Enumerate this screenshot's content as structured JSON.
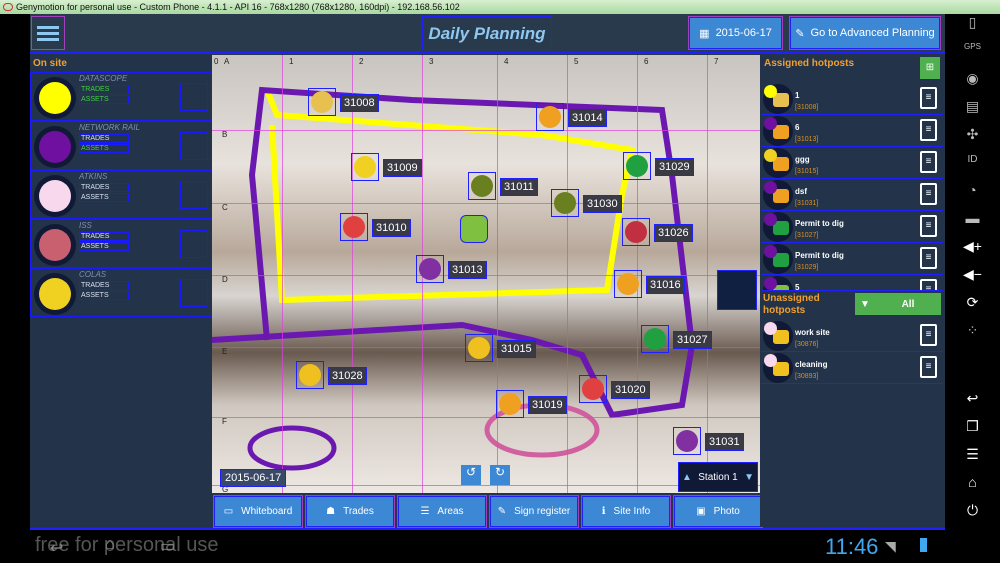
{
  "window": {
    "title": "Genymotion for personal use - Custom Phone - 4.1.1 - API 16 - 768x1280 (768x1280, 160dpi) - 192.168.56.102"
  },
  "header": {
    "title": "Daily Planning",
    "date_button": "2015-06-17",
    "advanced_button": "Go to Advanced Planning"
  },
  "onsite": {
    "heading": "On site",
    "orgs": [
      {
        "name": "DATASCOPE",
        "color": "#ffff00",
        "trades": "TRADES",
        "assets": "ASSETS",
        "trades_color": "#40d040",
        "assets_color": "#40d040"
      },
      {
        "name": "NETWORK RAIL",
        "color": "#7010a0",
        "trades": "TRADES",
        "assets": "ASSETS",
        "trades_color": "#d8e0f0",
        "assets_color": "#40d040"
      },
      {
        "name": "ATKINS",
        "color": "#f8d8ec",
        "trades": "TRADES",
        "assets": "ASSETS",
        "trades_color": "#d8e0f0",
        "assets_color": "#d8e0f0"
      },
      {
        "name": "ISS",
        "color": "#c86070",
        "trades": "TRADES",
        "assets": "ASSETS",
        "trades_color": "#d8e0f0",
        "assets_color": "#d8e0f0"
      },
      {
        "name": "COLAS",
        "color": "#f0d020",
        "trades": "TRADES",
        "assets": "ASSETS",
        "trades_color": "#d8e0f0",
        "assets_color": "#d8e0f0"
      }
    ]
  },
  "map": {
    "col_labels": [
      "0",
      "A",
      "1",
      "2",
      "3",
      "4",
      "5",
      "6",
      "7"
    ],
    "row_labels": [
      "B",
      "C",
      "D",
      "E",
      "F",
      "G"
    ],
    "hotspots": [
      "31008",
      "31014",
      "31009",
      "31011",
      "31030",
      "31029",
      "31010",
      "31026",
      "31013",
      "31016",
      "31027",
      "31015",
      "31028",
      "31020",
      "31019",
      "31031"
    ],
    "date": "2015-06-17",
    "station": "Station 1",
    "undo_icon": "rotate-left-icon",
    "redo_icon": "rotate-right-icon"
  },
  "bottom": {
    "buttons": [
      "Whiteboard",
      "Trades",
      "Areas",
      "Sign register",
      "Site Info",
      "Photo"
    ]
  },
  "assigned": {
    "heading": "Assigned hotposts",
    "items": [
      {
        "name": "1",
        "id": "[31008]",
        "dot": "#ffff00",
        "icon": "#e8c050"
      },
      {
        "name": "6",
        "id": "[31013]",
        "dot": "#7010a0",
        "icon": "#f0a020"
      },
      {
        "name": "ggg",
        "id": "[31015]",
        "dot": "#f0d020",
        "icon": "#f0a020"
      },
      {
        "name": "dsf",
        "id": "[31031]",
        "dot": "#7010a0",
        "icon": "#f0a020"
      },
      {
        "name": "Permit to dig",
        "id": "[31027]",
        "dot": "#7010a0",
        "icon": "#20a040"
      },
      {
        "name": "Permit to dig",
        "id": "[31029]",
        "dot": "#7010a0",
        "icon": "#20a040"
      },
      {
        "name": "5",
        "id": "",
        "dot": "#7010a0",
        "icon": "#80c040"
      }
    ]
  },
  "unassigned": {
    "heading": "Unassigned hotposts",
    "filter": "All",
    "items": [
      {
        "name": "work site",
        "id": "[30876]",
        "dot": "#f8d8ec",
        "icon": "#f0c020"
      },
      {
        "name": "cleaning",
        "id": "[30893]",
        "dot": "#f8d8ec",
        "icon": "#f0c020"
      }
    ]
  },
  "statusbar": {
    "watermark": "free for personal use",
    "time": "11:46"
  },
  "side": {
    "gps": "GPS",
    "id": "ID"
  }
}
